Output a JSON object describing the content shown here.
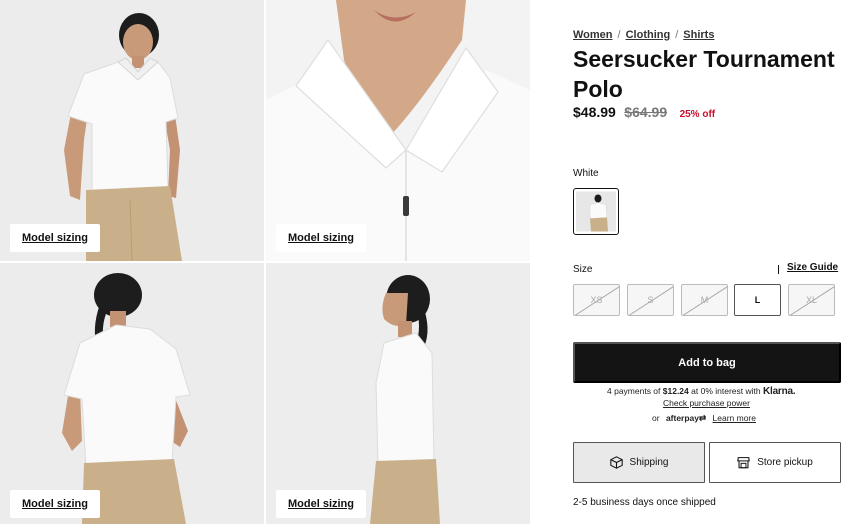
{
  "gallery": {
    "model_sizing_label": "Model sizing"
  },
  "product": {
    "breadcrumbs": [
      "Women",
      "Clothing",
      "Shirts"
    ],
    "title": "Seersucker Tournament Polo",
    "price": "$48.99",
    "original_price": "$64.99",
    "discount": "25% off",
    "discount_color": "#c8102e"
  },
  "color": {
    "label": "White"
  },
  "size": {
    "label": "Size",
    "guide_label": "Size Guide",
    "options": [
      {
        "label": "XS",
        "available": false
      },
      {
        "label": "S",
        "available": false
      },
      {
        "label": "M",
        "available": false
      },
      {
        "label": "L",
        "available": true
      },
      {
        "label": "XL",
        "available": false
      }
    ]
  },
  "cart": {
    "add_label": "Add to bag",
    "klarna_prefix": "4 payments of",
    "klarna_amount": "$12.24",
    "klarna_suffix": "at 0% interest with",
    "klarna_brand": "Klarna.",
    "check_power": "Check purchase power",
    "or_label": "or",
    "afterpay_brand": "afterpay",
    "learn_more": "Learn more"
  },
  "fulfillment": {
    "shipping_label": "Shipping",
    "pickup_label": "Store pickup",
    "shipping_icon": "box-icon",
    "pickup_icon": "store-icon",
    "note": "2-5 business days once shipped"
  }
}
